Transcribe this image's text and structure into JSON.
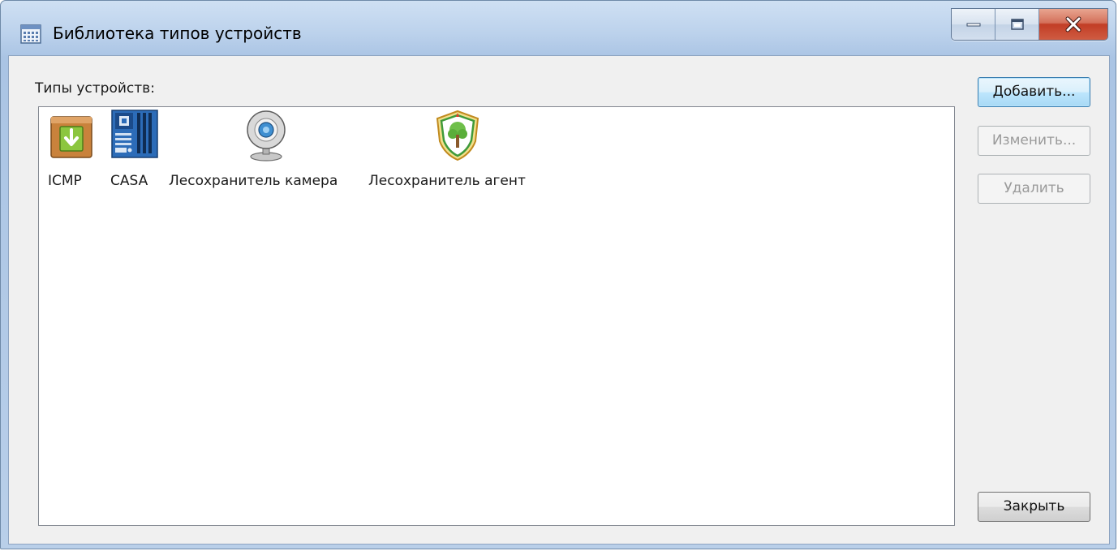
{
  "window": {
    "title": "Библиотека типов устройств"
  },
  "list": {
    "label": "Типы устройств:",
    "items": [
      {
        "label": "ICMP",
        "icon": "package-download-icon"
      },
      {
        "label": "CASA",
        "icon": "motherboard-icon"
      },
      {
        "label": "Лесохранитель камера",
        "icon": "webcam-icon"
      },
      {
        "label": "Лесохранитель агент",
        "icon": "forest-shield-icon"
      }
    ]
  },
  "buttons": {
    "add": "Добавить...",
    "edit": "Изменить...",
    "delete": "Удалить",
    "close": "Закрыть"
  },
  "states": {
    "edit_enabled": false,
    "delete_enabled": false
  }
}
